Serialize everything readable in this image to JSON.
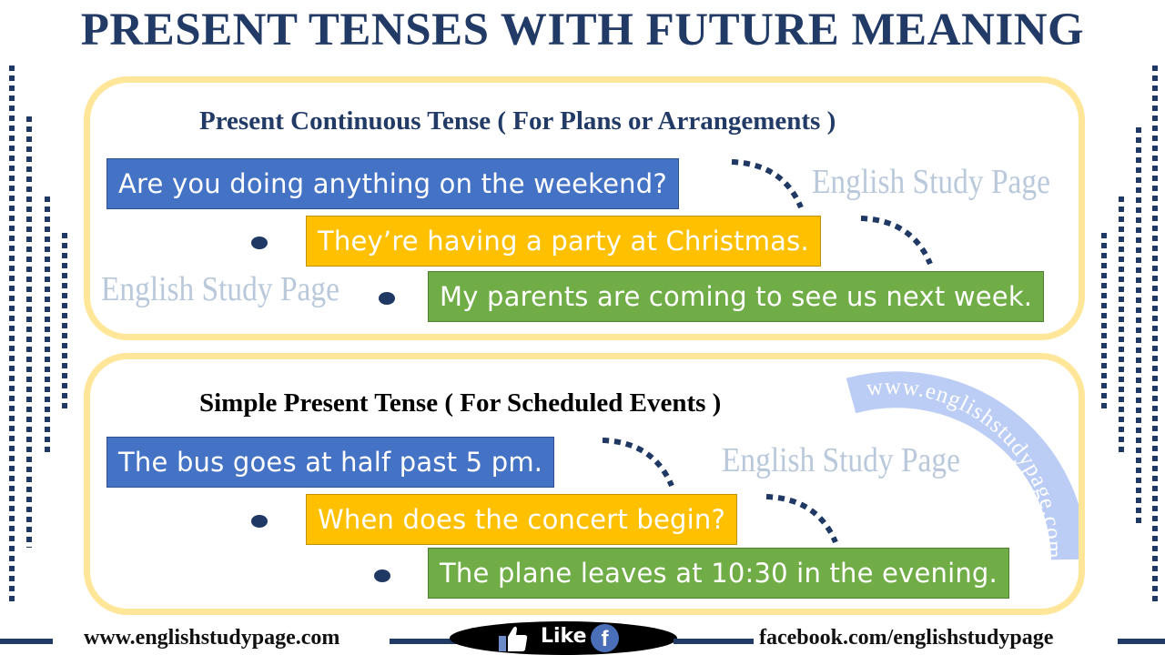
{
  "title": "PRESENT TENSES WITH FUTURE MEANING",
  "sections": [
    {
      "heading": "Present Continuous Tense ( For Plans or Arrangements )",
      "examples": [
        {
          "text": "Are you doing anything on the weekend?",
          "color": "#4472c4"
        },
        {
          "text": "They’re having a party at Christmas.",
          "color": "#ffc000"
        },
        {
          "text": "My parents are coming to see us next week.",
          "color": "#70ad47"
        }
      ]
    },
    {
      "heading": "Simple Present Tense ( For Scheduled Events )",
      "examples": [
        {
          "text": "The bus goes at half past 5 pm.",
          "color": "#4472c4"
        },
        {
          "text": "When does the concert begin?",
          "color": "#ffc000"
        },
        {
          "text": "The plane leaves at 10:30 in the evening.",
          "color": "#70ad47"
        }
      ]
    }
  ],
  "watermarks": {
    "brand": "English Study Page",
    "seal_url": "www.englishstudypage.com"
  },
  "footer": {
    "website": "www.englishstudypage.com",
    "like_label": "Like",
    "facebook_glyph": "f",
    "facebook": "facebook.com/englishstudypage"
  },
  "colors": {
    "title": "#213a66",
    "panel_border": "#ffe699",
    "blue": "#4472c4",
    "orange": "#ffc000",
    "green": "#70ad47",
    "decor": "#1f3864",
    "watermark": "#b9c9db"
  }
}
